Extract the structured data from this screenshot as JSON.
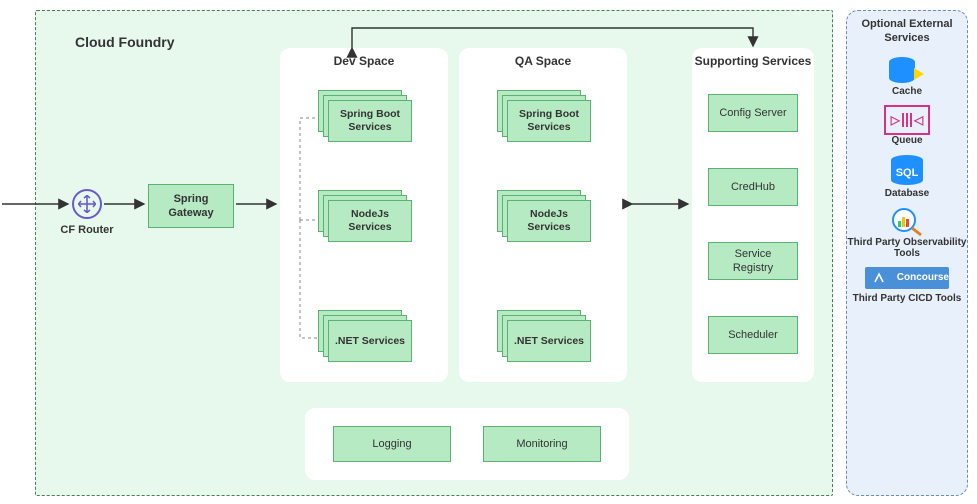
{
  "title": "Cloud Foundry",
  "cf_router": "CF Router",
  "spring_gateway": "Spring Gateway",
  "dev_space": {
    "title": "Dev Space",
    "services": [
      "Spring Boot Services",
      "NodeJs Services",
      ".NET Services"
    ]
  },
  "qa_space": {
    "title": "QA Space",
    "services": [
      "Spring Boot Services",
      "NodeJs Services",
      ".NET Services"
    ]
  },
  "supporting": {
    "title": "Supporting Services",
    "items": [
      "Config Server",
      "CredHub",
      "Service Registry",
      "Scheduler"
    ]
  },
  "bottom": {
    "logging": "Logging",
    "monitoring": "Monitoring"
  },
  "external": {
    "title": "Optional External Services",
    "items": [
      "Cache",
      "Queue",
      "Database",
      "Third Party Observability Tools",
      "Third Party CICD Tools"
    ],
    "concourse": "Concourse"
  }
}
